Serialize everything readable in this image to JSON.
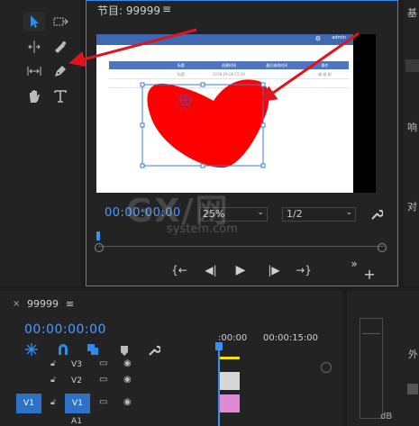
{
  "program_monitor": {
    "title": "节目: 99999",
    "menu_icon": "≡",
    "timecode": "00:00:00:00",
    "zoom": "25%",
    "resolution": "1/2",
    "video": {
      "app_user": "admin",
      "table_headers": [
        "",
        "标题",
        "创建时间",
        "最后修改时间",
        "操作"
      ],
      "row": [
        "",
        "标题",
        "2018-09-06 15:00",
        "",
        "编 辑 删"
      ]
    },
    "transport": {
      "mark_in": "{←",
      "step_back": "◀|",
      "play": "▶",
      "step_forward": "|▶",
      "mark_out": "→}",
      "more": "»",
      "add": "+"
    }
  },
  "timeline": {
    "close": "×",
    "tab": "99999",
    "menu": "≡",
    "timecode": "00:00:00:00",
    "ruler": [
      ":00:00",
      "00:00:15:00"
    ],
    "tracks": [
      {
        "name": "V3",
        "source": ""
      },
      {
        "name": "V2",
        "source": ""
      },
      {
        "name": "V1",
        "source": "V1"
      },
      {
        "name": "A1",
        "source": ""
      }
    ],
    "clip_colors": {
      "v2": "#d7d7d7",
      "v1": "#e08ad3"
    }
  },
  "meter": {
    "value": "dB"
  },
  "right_panel": {
    "label_a": "基",
    "label_b": "响",
    "label_c": "对",
    "label_d": "外"
  },
  "watermark": {
    "main": "GX/网",
    "sub": "system.com"
  },
  "colors": {
    "accent_blue": "#2d8ceb",
    "timecode_blue": "#4a9cff",
    "heart": "#ff0000",
    "arrow": "#e0141e"
  }
}
